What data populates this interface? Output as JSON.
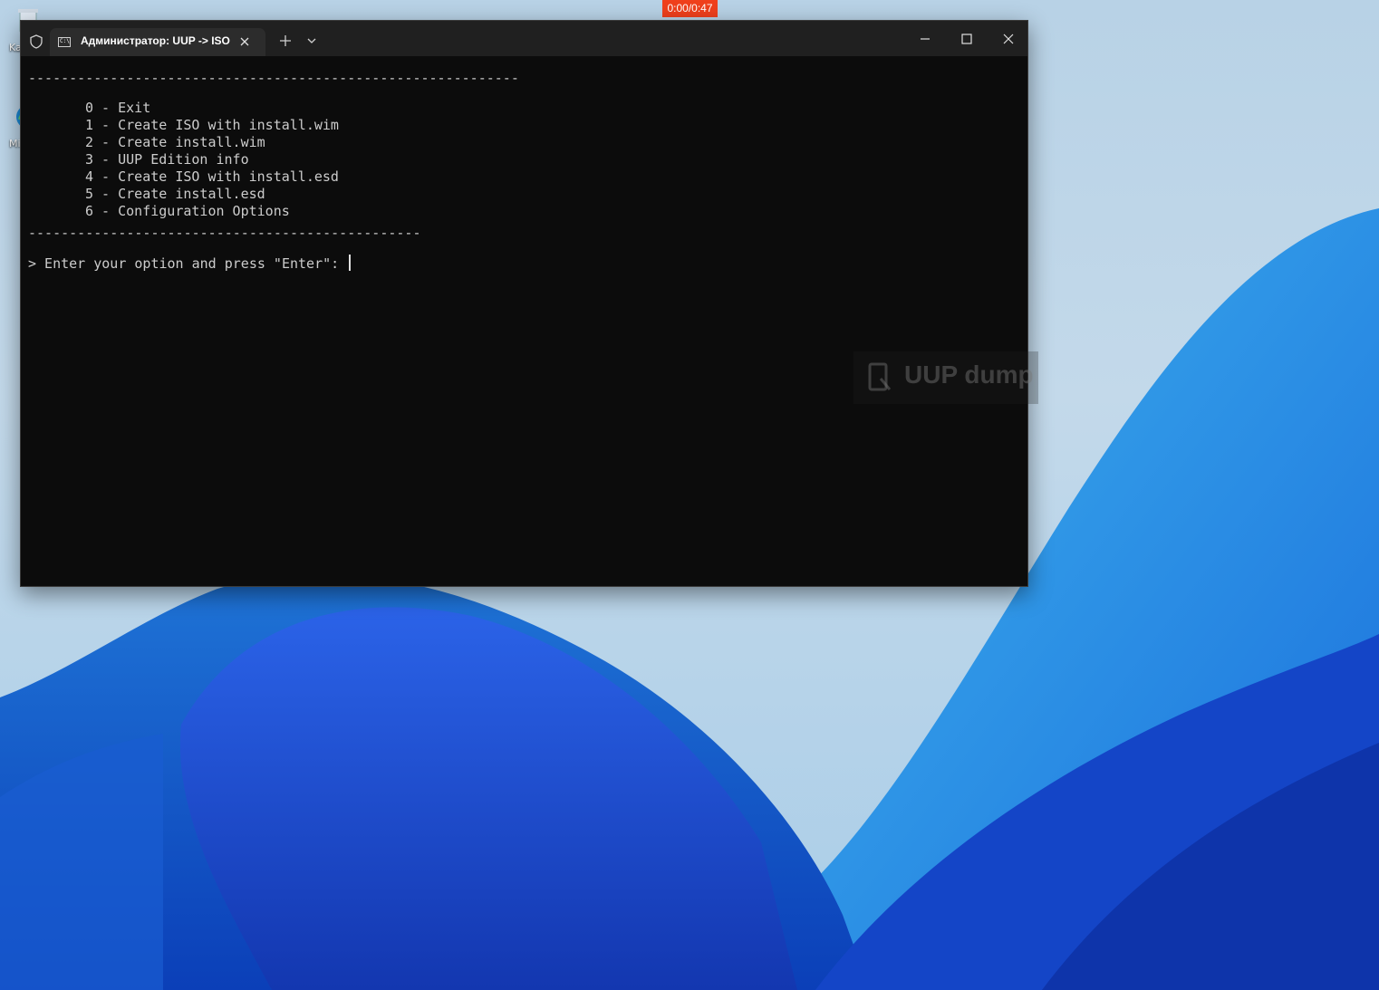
{
  "recording": {
    "timer": "0:00/0:47"
  },
  "desktop": {
    "icons": [
      {
        "name": "recycle-bin",
        "caption": "Ka"
      },
      {
        "name": "edge",
        "caption": "Mi"
      }
    ]
  },
  "window": {
    "tab_title": "Администратор:  UUP -> ISO",
    "tab_icon": "cmd-icon",
    "controls": [
      "shield-icon",
      "close-icon",
      "plus-icon",
      "chevron-down-icon",
      "minimize-icon",
      "maximize-icon",
      "close-icon"
    ]
  },
  "terminal": {
    "divider_top": "------------------------------------------------------------",
    "menu": [
      "0 - Exit",
      "1 - Create ISO with install.wim",
      "2 - Create install.wim",
      "3 - UUP Edition info",
      "4 - Create ISO with install.esd",
      "5 - Create install.esd",
      "6 - Configuration Options"
    ],
    "divider_bottom": "------------------------------------------------",
    "prompt": "> Enter your option and press \"Enter\": "
  },
  "watermark": {
    "text": "UUP dump"
  },
  "colors": {
    "terminal_bg": "#0c0c0c",
    "titlebar_bg": "#202020",
    "tab_bg": "#2c2c2c",
    "text": "#cccccc",
    "timer_bg": "#f0401c"
  }
}
